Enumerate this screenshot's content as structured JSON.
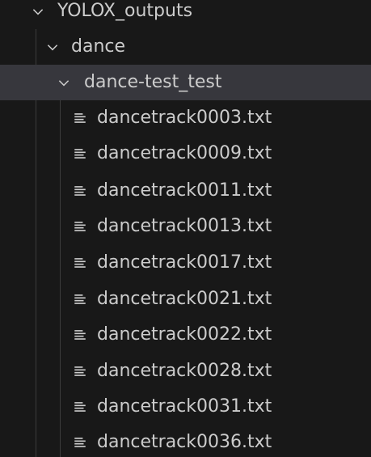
{
  "explorer": {
    "root_folder": {
      "label": "YOLOX_outputs",
      "icon": "chevron-down-icon"
    },
    "sub_folder": {
      "label": "dance",
      "icon": "chevron-down-icon"
    },
    "selected_folder": {
      "label": "dance-test_test",
      "icon": "chevron-down-icon"
    },
    "files": [
      {
        "label": "dancetrack0003.txt",
        "icon": "text-file-icon"
      },
      {
        "label": "dancetrack0009.txt",
        "icon": "text-file-icon"
      },
      {
        "label": "dancetrack0011.txt",
        "icon": "text-file-icon"
      },
      {
        "label": "dancetrack0013.txt",
        "icon": "text-file-icon"
      },
      {
        "label": "dancetrack0017.txt",
        "icon": "text-file-icon"
      },
      {
        "label": "dancetrack0021.txt",
        "icon": "text-file-icon"
      },
      {
        "label": "dancetrack0022.txt",
        "icon": "text-file-icon"
      },
      {
        "label": "dancetrack0028.txt",
        "icon": "text-file-icon"
      },
      {
        "label": "dancetrack0031.txt",
        "icon": "text-file-icon"
      },
      {
        "label": "dancetrack0036.txt",
        "icon": "text-file-icon"
      }
    ]
  },
  "colors": {
    "background": "#181818",
    "selected_row": "#37373d",
    "text": "#cccccc",
    "indent_guide": "#3c3c3c"
  }
}
